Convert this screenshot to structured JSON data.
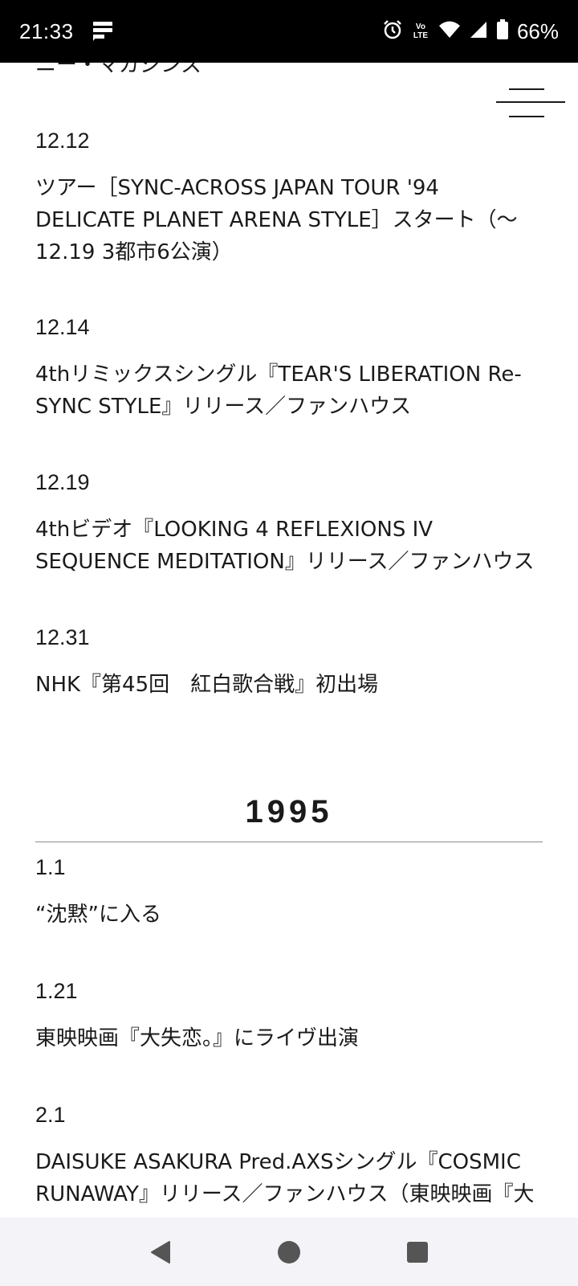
{
  "status_bar": {
    "time": "21:33",
    "network_label": "Vo LTE",
    "battery": "66%",
    "icons": [
      "notification-icon",
      "alarm-icon",
      "volte-icon",
      "wifi-icon",
      "signal-icon",
      "battery-icon"
    ]
  },
  "page": {
    "cut_off_line": "ニー・マガジンズ",
    "menu_icon": "hamburger-menu-icon",
    "year_heading": "1995",
    "entries_1994": [
      {
        "date": "12.12",
        "text": "ツアー［SYNC-ACROSS JAPAN TOUR '94 DELICATE PLANET ARENA STYLE］スタート（〜12.19 3都市6公演）"
      },
      {
        "date": "12.14",
        "text": "4thリミックスシングル『TEAR'S LIBERATION Re-SYNC STYLE』リリース／ファンハウス"
      },
      {
        "date": "12.19",
        "text": "4thビデオ『LOOKING 4 REFLEXIONS IV SEQUENCE MEDITATION』リリース／ファンハウス"
      },
      {
        "date": "12.31",
        "text": "NHK『第45回　紅白歌合戦』初出場"
      }
    ],
    "entries_1995": [
      {
        "date": "1.1",
        "text": "“沈黙”に入る"
      },
      {
        "date": "1.21",
        "text": "東映映画『大失恋。』にライヴ出演"
      },
      {
        "date": "2.1",
        "text": "DAISUKE ASAKURA Pred.AXSシングル『COSMIC RUNAWAY』リリース／ファンハウス（東映映画『大"
      }
    ]
  },
  "nav_bar": {
    "icons": [
      "back-icon",
      "home-icon",
      "recents-icon"
    ]
  }
}
